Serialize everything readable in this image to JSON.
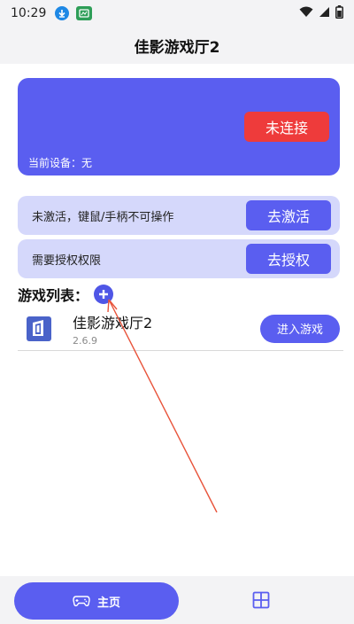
{
  "status_bar": {
    "time": "10:29",
    "icons": [
      "download-icon",
      "app-notification-icon",
      "wifi-icon",
      "signal-icon",
      "battery-icon"
    ]
  },
  "appbar": {
    "title": "佳影游戏厅2"
  },
  "device_card": {
    "connect_label": "未连接",
    "device_text": "当前设备：无"
  },
  "activation": {
    "label": "未激活，键鼠/手柄不可操作",
    "action_label": "去激活"
  },
  "authorization": {
    "label": "需要授权权限",
    "action_label": "去授权"
  },
  "game_list": {
    "title": "游戏列表：",
    "items": [
      {
        "name": "佳影游戏厅2",
        "version": "2.6.9",
        "enter_label": "进入游戏"
      }
    ]
  },
  "bottom_nav": {
    "home_label": "主页"
  },
  "colors": {
    "primary": "#5a5ef0",
    "light_primary": "#d5d8fb",
    "danger": "#ee3b3b",
    "annotation_arrow": "#e8533a"
  }
}
